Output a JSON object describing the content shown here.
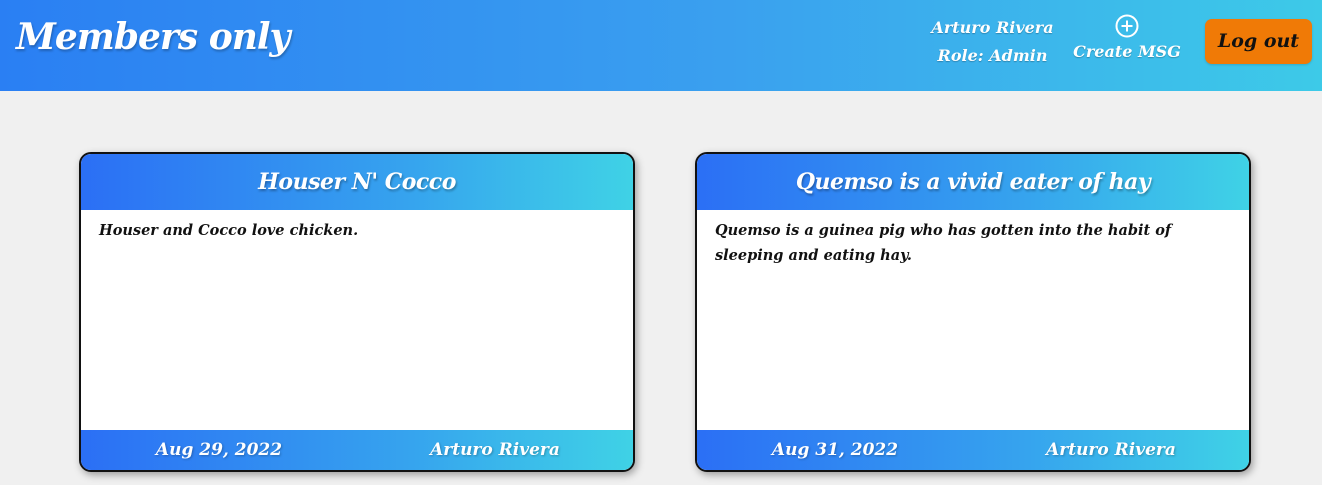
{
  "header": {
    "brand": "Members only",
    "user_name": "Arturo Rivera",
    "user_role": "Role: Admin",
    "create_label": "Create MSG",
    "create_icon": "plus-circle-icon",
    "logout_label": "Log out"
  },
  "colors": {
    "header_gradient_start": "#2a7ff3",
    "header_gradient_end": "#3dcae8",
    "logout_button": "#f07a06",
    "page_background": "#f0f0f0"
  },
  "messages": [
    {
      "title": "Houser N' Cocco",
      "body": "Houser and Cocco love chicken.",
      "date": "Aug 29, 2022",
      "author": "Arturo Rivera"
    },
    {
      "title": "Quemso is a vivid eater of hay",
      "body": "Quemso is a guinea pig who has gotten into the habit of sleeping and eating hay.",
      "date": "Aug 31, 2022",
      "author": "Arturo Rivera"
    }
  ]
}
